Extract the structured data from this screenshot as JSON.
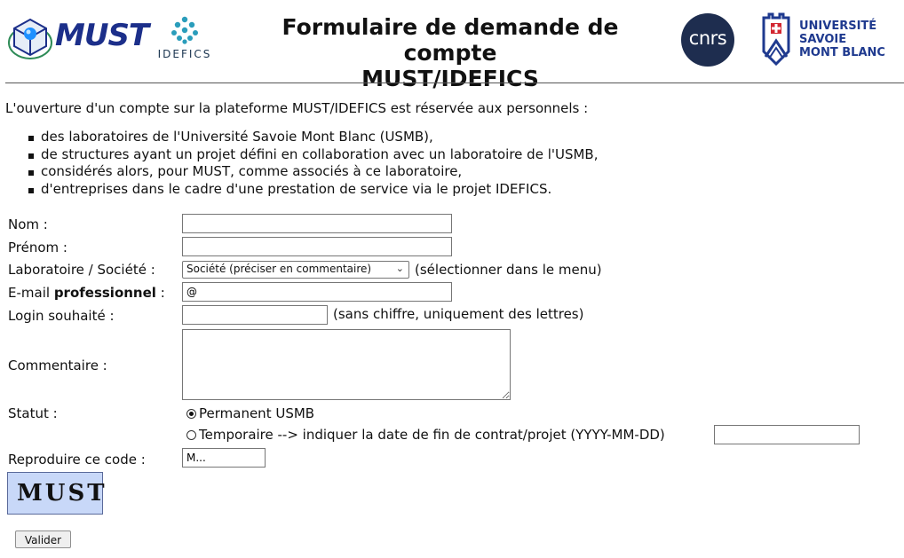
{
  "header": {
    "title": "Formulaire de demande de compte MUST/IDEFICS",
    "title_line1": "Formulaire de demande de compte",
    "title_line2": "MUST/IDEFICS",
    "logos": {
      "must": "MUST",
      "idefics": "IDEFICS",
      "cnrs": "cnrs",
      "usmb_line1": "UNIVERSITÉ",
      "usmb_line2": "SAVOIE",
      "usmb_line3": "MONT BLANC"
    }
  },
  "intro": "L'ouverture d'un compte sur la plateforme MUST/IDEFICS est réservée aux personnels :",
  "bullets": [
    "des laboratoires de l'Université Savoie Mont Blanc (USMB),",
    "de structures ayant un projet défini en collaboration avec un laboratoire de l'USMB,",
    "considérés alors, pour MUST, comme associés à ce laboratoire,",
    "d'entreprises dans le cadre d'une prestation de service via le projet IDEFICS."
  ],
  "form": {
    "nom_label": "Nom :",
    "nom_value": "",
    "prenom_label": "Prénom :",
    "prenom_value": "",
    "labo_label": "Laboratoire / Société :",
    "labo_selected": "Société (préciser en commentaire)",
    "labo_hint": "(sélectionner dans le menu)",
    "email_label_prefix": "E-mail",
    "email_label_bold": "professionnel",
    "email_label_suffix": ":",
    "email_value": "@",
    "login_label": "Login souhaité :",
    "login_value": "",
    "login_hint": "(sans chiffre, uniquement des lettres)",
    "commentaire_label": "Commentaire :",
    "commentaire_value": "",
    "statut_label": "Statut :",
    "statut_options": [
      {
        "label": "Permanent USMB",
        "selected": true
      },
      {
        "label": "Temporaire --> indiquer la date de fin de contrat/projet (YYYY-MM-DD)",
        "selected": false
      }
    ],
    "date_fin_value": "",
    "captcha_label": "Reproduire ce code :",
    "captcha_value": "M...",
    "captcha_image_text": "MUST",
    "submit_label": "Valider"
  },
  "colors": {
    "must_blue": "#1c2f8a",
    "cnrs_navy": "#1e2d4f",
    "usmb_blue": "#1f3a8f",
    "usmb_red": "#d22630",
    "captcha_bg": "#c8d8f8"
  }
}
